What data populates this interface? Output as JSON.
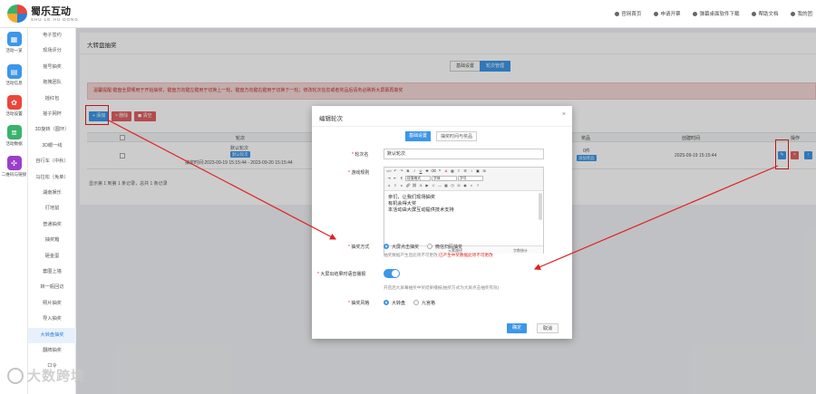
{
  "header": {
    "logo_cn": "蜀乐互动",
    "logo_en": "SHU LE HU DONG",
    "links": [
      "官网首页",
      "申请开票",
      "弹幕桌面软件下载",
      "帮助文档",
      "我的团"
    ]
  },
  "rail": [
    {
      "label": "活动一览",
      "color": "#3d96e8",
      "icon": "grid-icon"
    },
    {
      "label": "活动信息",
      "color": "#3d96e8",
      "icon": "info-icon"
    },
    {
      "label": "活动设置",
      "color": "#e9473a",
      "icon": "gear-icon"
    },
    {
      "label": "活动数据",
      "color": "#3bb26b",
      "icon": "database-icon"
    },
    {
      "label": "二维码与链接",
      "color": "#9b3fc9",
      "icon": "qrcode-icon"
    }
  ],
  "submenu": [
    "电子签约",
    "现场评分",
    "摇号抽奖",
    "拖拽团队",
    "摇红包",
    "摇子网杯",
    "3D旋转（圆环）",
    "3D眼一线",
    "自行车（中秋）",
    "马拉松（免单）",
    "湖南娱乐",
    "打地鼠",
    "普通抽奖",
    "抽奖箱",
    "砸金蛋",
    "套圈上墙",
    "转一瓶回访",
    "照片抽奖",
    "导入抽奖",
    "大转盘抽奖",
    "翻牌抽奖",
    "口令"
  ],
  "panel": {
    "title": "大转盘抽奖",
    "seg_tabs": [
      "基础设置",
      "轮次管理"
    ],
    "alert": "温馨提醒:键盘全屏哪用于开始抽奖，键盘方向键左键用于切换上一轮，键盘方向键右键用于切换下一轮；修改轮次信息或者奖品后请务必刷新大屏幕再做奖",
    "toolbar": {
      "add": "+ 添加",
      "delete": "× 删除",
      "clear": "◼ 清空"
    },
    "table": {
      "headers": [
        "轮次",
        "奖品",
        "创建时间",
        "操作"
      ],
      "row": {
        "name": "默认轮次",
        "badge": "默认轮次",
        "time_range": "抽奖时间:2023-09-19 15:15:44 - 2023-09-20 15:15:44",
        "prize_count": "0件",
        "prize_btn": "添加奖品",
        "created": "2025-09-19 15:15:44"
      }
    },
    "footer": "显示第 1 到第 1 条记录，总共 1 条记录"
  },
  "modal": {
    "title": "编辑轮次",
    "tabs": [
      "基础设置",
      "抽奖时间与奖品"
    ],
    "round_name_label": "轮次名",
    "round_name_value": "默认轮次",
    "rules_label": "游戏规则",
    "editor": {
      "font_family": "字体",
      "font_size": "字号",
      "para_format": "段落格式",
      "body_lines": [
        "亲们，让我们现场抽奖",
        "有机会得大奖",
        "本活动由大屏互动提供技术支持"
      ],
      "path": "元素路径",
      "counter": "字数统计"
    },
    "draw_mode_label": "抽奖方式",
    "draw_mode_options": [
      "大屏点击抽奖",
      "微信扫码抽奖"
    ],
    "draw_mode_hint": "抽奖数据产生后此项不可更改;",
    "draw_mode_hint_red": "已产生中奖数据此项不可更改",
    "voice_label": "大屏出结果时语音播报",
    "voice_hint": "开启后大屏幕抽奖中奖结果播报(抽奖方式为大屏点击抽奖有效)",
    "style_label": "抽奖风格",
    "style_options": [
      "大转盘",
      "九宫格"
    ],
    "confirm": "确定",
    "cancel": "取消"
  },
  "watermark": "大数跨境"
}
